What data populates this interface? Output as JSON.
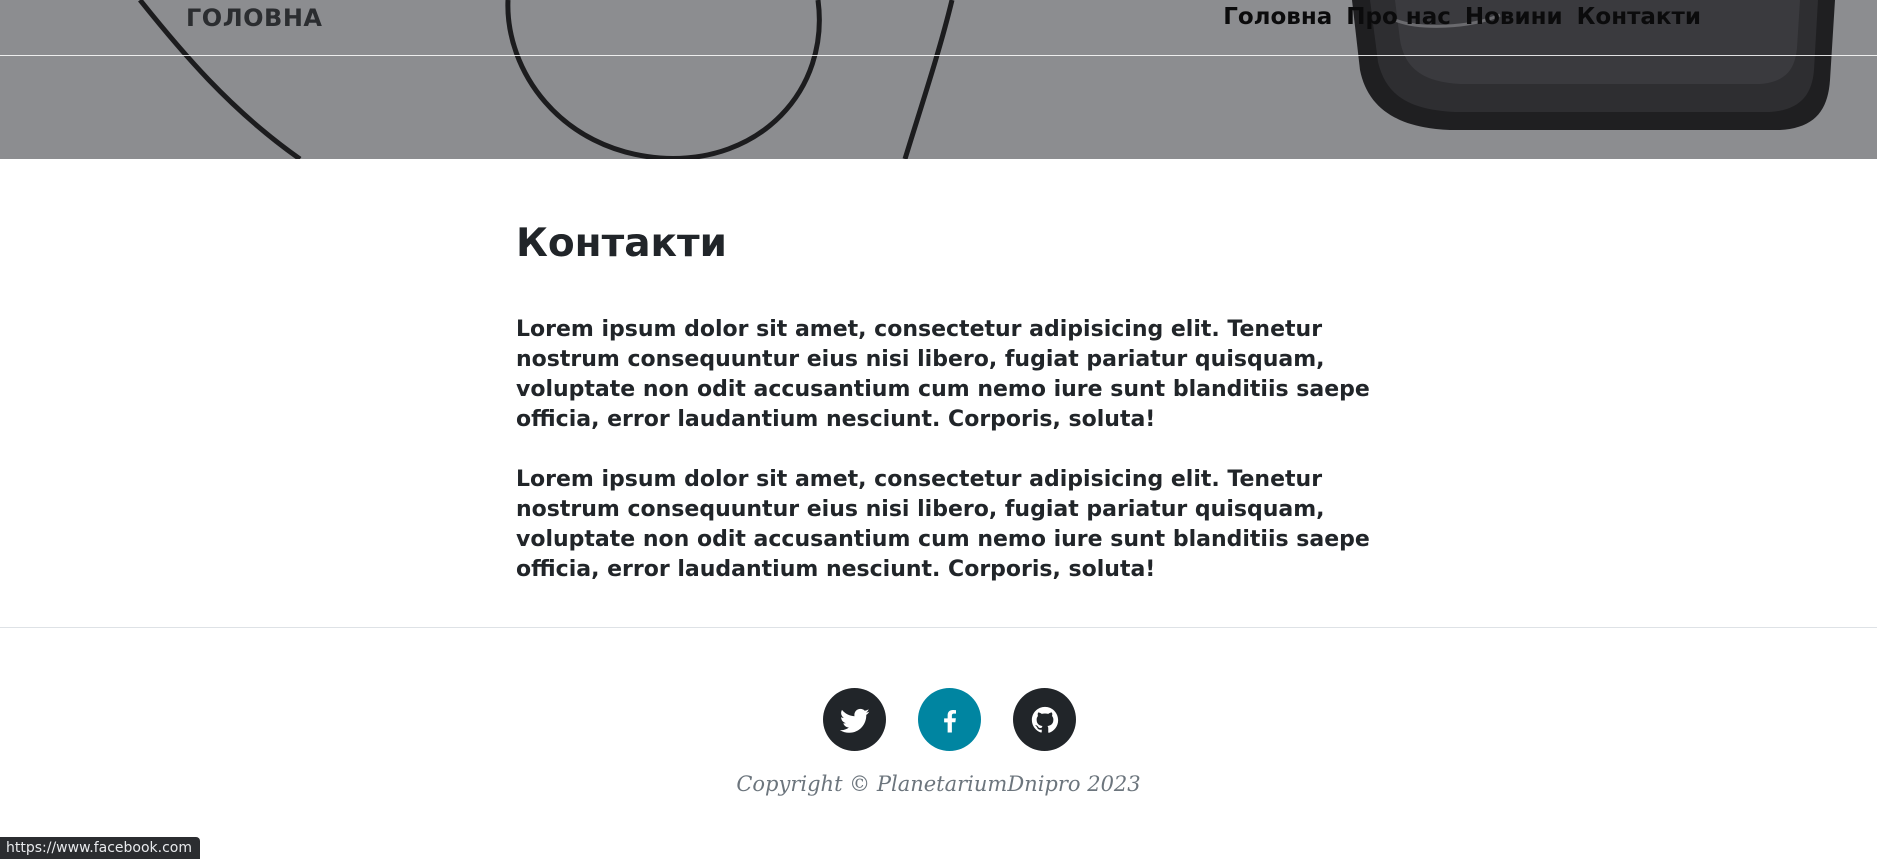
{
  "header": {
    "brand": "ГОЛОВНА",
    "nav": [
      {
        "label": "Головна"
      },
      {
        "label": "Про нас"
      },
      {
        "label": "Новини"
      },
      {
        "label": "Контакти"
      }
    ]
  },
  "main": {
    "title": "Контакти",
    "paragraphs": [
      "Lorem ipsum dolor sit amet, consectetur adipisicing elit. Tenetur nostrum consequuntur eius nisi libero, fugiat pariatur quisquam, voluptate non odit accusantium cum nemo iure sunt blanditiis saepe officia, error laudantium nesciunt. Corporis, soluta!",
      "Lorem ipsum dolor sit amet, consectetur adipisicing elit. Tenetur nostrum consequuntur eius nisi libero, fugiat pariatur quisquam, voluptate non odit accusantium cum nemo iure sunt blanditiis saepe officia, error laudantium nesciunt. Corporis, soluta!"
    ]
  },
  "footer": {
    "social": [
      {
        "icon": "twitter-icon",
        "color": "#212529"
      },
      {
        "icon": "facebook-icon",
        "color": "#0085a1"
      },
      {
        "icon": "github-icon",
        "color": "#212529"
      }
    ],
    "copyright": "Copyright © PlanetariumDnipro 2023"
  },
  "status_bar": {
    "url": "https://www.facebook.com"
  }
}
